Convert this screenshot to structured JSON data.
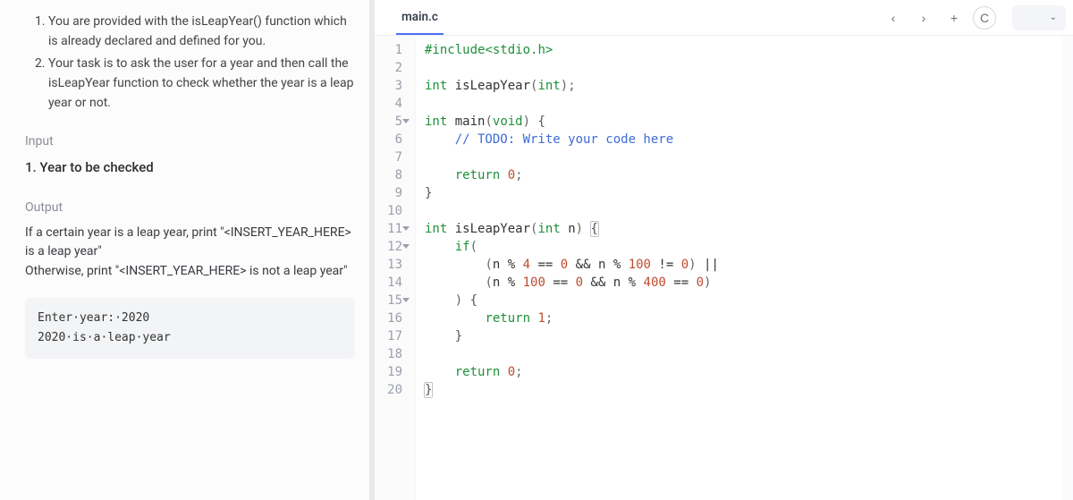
{
  "instructions": {
    "items": [
      "You are provided with the isLeapYear() function which is already declared and defined for you.",
      "Your task is to ask the user for a year and then call the isLeapYear function to check whether the year is a leap year or not."
    ]
  },
  "input_section": {
    "heading": "Input",
    "body": "1. Year to be checked"
  },
  "output_section": {
    "heading": "Output",
    "body": "If a certain year is a leap year, print \"<INSERT_YEAR_HERE> is a leap year\"\nOtherwise, print \"<INSERT_YEAR_HERE> is not a leap year\""
  },
  "example": {
    "line1": "Enter·year:·2020",
    "line2": "2020·is·a·leap·year"
  },
  "tabs": {
    "active": "main.c",
    "lang": "C"
  },
  "code": {
    "lines": [
      {
        "n": 1,
        "fold": false,
        "html": "<span class='tok-pp'>#include</span><span class='tok-inc'>&lt;stdio.h&gt;</span>"
      },
      {
        "n": 2,
        "fold": false,
        "html": ""
      },
      {
        "n": 3,
        "fold": false,
        "html": "<span class='tok-type'>int</span> <span class='tok-fn'>isLeapYear</span><span class='tok-punc'>(</span><span class='tok-type'>int</span><span class='tok-punc'>);</span>"
      },
      {
        "n": 4,
        "fold": false,
        "html": ""
      },
      {
        "n": 5,
        "fold": true,
        "html": "<span class='tok-type'>int</span> <span class='tok-fn'>main</span><span class='tok-punc'>(</span><span class='tok-type'>void</span><span class='tok-punc'>)</span> <span class='tok-brace'>{</span>"
      },
      {
        "n": 6,
        "fold": false,
        "html": "    <span class='tok-cmt'>// TODO: Write your code here</span>"
      },
      {
        "n": 7,
        "fold": false,
        "html": ""
      },
      {
        "n": 8,
        "fold": false,
        "html": "    <span class='tok-kw'>return</span> <span class='tok-num'>0</span><span class='tok-punc'>;</span>"
      },
      {
        "n": 9,
        "fold": false,
        "html": "<span class='tok-brace'>}</span>"
      },
      {
        "n": 10,
        "fold": false,
        "html": ""
      },
      {
        "n": 11,
        "fold": true,
        "html": "<span class='tok-type'>int</span> <span class='tok-fn'>isLeapYear</span><span class='tok-punc'>(</span><span class='tok-type'>int</span> n<span class='tok-punc'>)</span> <span class='tok-brace tok-active-brace'>{</span>"
      },
      {
        "n": 12,
        "fold": true,
        "html": "    <span class='tok-kw'>if</span><span class='tok-punc'>(</span>"
      },
      {
        "n": 13,
        "fold": false,
        "html": "        <span class='tok-punc'>(</span>n <span class='tok-op'>%</span> <span class='tok-num'>4</span> <span class='tok-op'>==</span> <span class='tok-num'>0</span> <span class='tok-op'>&amp;&amp;</span> n <span class='tok-op'>%</span> <span class='tok-num'>100</span> <span class='tok-op'>!=</span> <span class='tok-num'>0</span><span class='tok-punc'>)</span> <span class='tok-op'>||</span>"
      },
      {
        "n": 14,
        "fold": false,
        "html": "        <span class='tok-punc'>(</span>n <span class='tok-op'>%</span> <span class='tok-num'>100</span> <span class='tok-op'>==</span> <span class='tok-num'>0</span> <span class='tok-op'>&amp;&amp;</span> n <span class='tok-op'>%</span> <span class='tok-num'>400</span> <span class='tok-op'>==</span> <span class='tok-num'>0</span><span class='tok-punc'>)</span>"
      },
      {
        "n": 15,
        "fold": true,
        "html": "    <span class='tok-punc'>)</span> <span class='tok-brace'>{</span>"
      },
      {
        "n": 16,
        "fold": false,
        "html": "        <span class='tok-kw'>return</span> <span class='tok-num'>1</span><span class='tok-punc'>;</span>"
      },
      {
        "n": 17,
        "fold": false,
        "html": "    <span class='tok-brace'>}</span>"
      },
      {
        "n": 18,
        "fold": false,
        "html": ""
      },
      {
        "n": 19,
        "fold": false,
        "html": "    <span class='tok-kw'>return</span> <span class='tok-num'>0</span><span class='tok-punc'>;</span>"
      },
      {
        "n": 20,
        "fold": false,
        "html": "<span class='tok-brace tok-active-brace'>}</span>"
      }
    ]
  }
}
